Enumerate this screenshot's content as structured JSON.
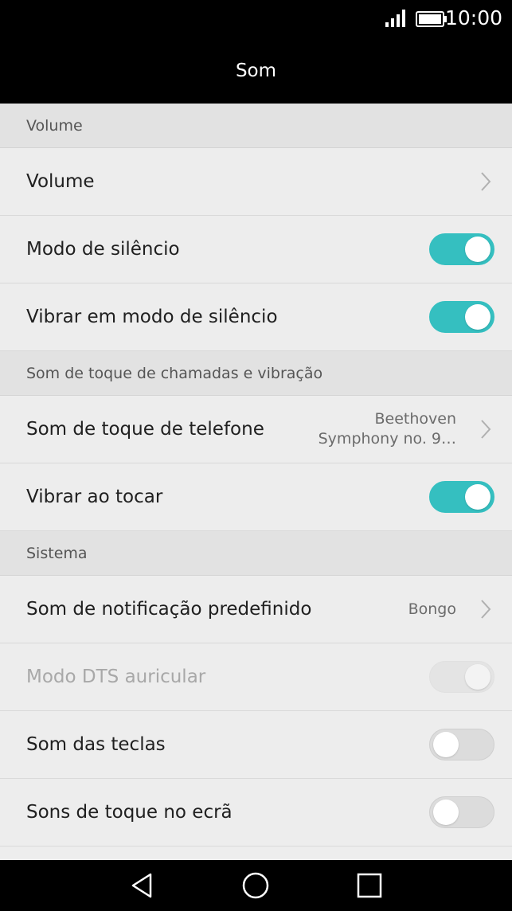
{
  "status": {
    "time": "10:00"
  },
  "header": {
    "title": "Som"
  },
  "sections": {
    "volume": "Volume",
    "ringtone": "Som de toque de chamadas e vibração",
    "system": "Sistema"
  },
  "rows": {
    "volume": {
      "label": "Volume"
    },
    "silent_mode": {
      "label": "Modo de silêncio",
      "enabled": true
    },
    "vibrate_silent": {
      "label": "Vibrar em modo de silêncio",
      "enabled": true
    },
    "phone_ringtone": {
      "label": "Som de toque de telefone",
      "value_line1": "Beethoven",
      "value_line2": "Symphony no. 9…"
    },
    "vibrate_ring": {
      "label": "Vibrar ao tocar",
      "enabled": true
    },
    "notification_sound": {
      "label": "Som de notificação predefinido",
      "value": "Bongo"
    },
    "dts_mode": {
      "label": "Modo DTS auricular",
      "enabled": true,
      "disabled": true
    },
    "key_sounds": {
      "label": "Som das teclas",
      "enabled": false
    },
    "touch_sounds": {
      "label": "Sons de toque no ecrã",
      "enabled": false
    }
  },
  "colors": {
    "accent": "#35bfc0",
    "bar": "#000000",
    "background": "#ededed",
    "section": "#e2e2e2"
  },
  "icons": [
    "signal-icon",
    "battery-icon",
    "chevron-right-icon",
    "back-icon",
    "home-icon",
    "recents-icon"
  ]
}
